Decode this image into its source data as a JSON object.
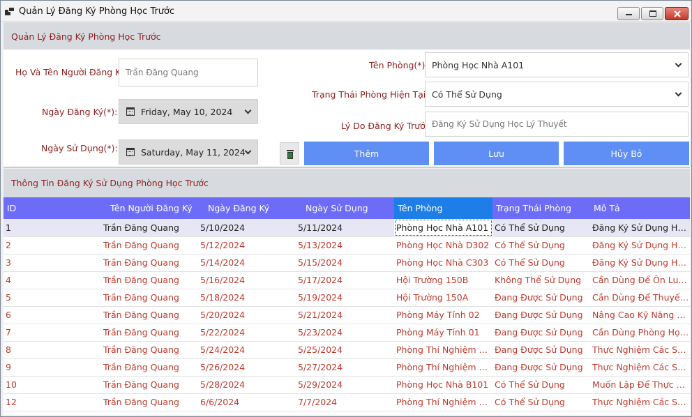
{
  "window": {
    "title": "Quản Lý Đăng Ký Phòng Học Trước"
  },
  "form_group": {
    "title": "Quản Lý Đăng Ký Phòng Học Trước",
    "requester_label": "Họ Và Tên Người Đăng Ký:",
    "requester_value": "Trần Đăng Quang",
    "register_date_label": "Ngày Đăng Ký(*):",
    "register_date_value": "Friday, May 10, 2024",
    "use_date_label": "Ngày Sử Dụng(*):",
    "use_date_value": "Saturday, May 11, 2024",
    "room_label": "Tên Phòng(*):",
    "room_value": "Phòng Học Nhà A101",
    "status_label": "Trạng Thái Phòng Hiện Tại(*):",
    "status_value": "Có Thể Sử Dụng",
    "reason_label": "Lý Do Đăng Ký Trước:",
    "reason_value": "Đăng Ký Sử Dụng Học Lý Thuyết",
    "add_label": "Thêm",
    "save_label": "Lưu",
    "cancel_label": "Hủy Bỏ"
  },
  "grid_group": {
    "title": "Thông Tin Đăng Ký Sử Dụng Phòng Học Trước",
    "columns": [
      "ID",
      "Tên Người Đăng Ký",
      "Ngày Đăng Ký",
      "Ngày Sử Dụng",
      "Tên Phòng",
      "Trạng Thái Phòng",
      "Mô Tả"
    ],
    "rows": [
      [
        "1",
        "Trần Đăng Quang",
        "5/10/2024",
        "5/11/2024",
        "Phòng Học Nhà A101",
        "Có Thể Sử Dụng",
        "Đăng Ký Sử Dụng Học L..."
      ],
      [
        "2",
        "Trần Đăng Quang",
        "5/12/2024",
        "5/13/2024",
        "Phòng Học Nhà D302",
        "Có Thể Sử Dụng",
        "Đăng Ký Sử Dụng Học ..."
      ],
      [
        "3",
        "Trần Đăng Quang",
        "5/14/2024",
        "5/15/2024",
        "Phòng Học Nhà C303",
        "Có Thể Sử Dụng",
        "Đăng Ký Sử Dụng Học ..."
      ],
      [
        "4",
        "Trần Đăng Quang",
        "5/16/2024",
        "5/17/2024",
        "Hội Trường 150B",
        "Không Thể Sử Dụng",
        "Cần Dùng Để Ôn Luyện..."
      ],
      [
        "5",
        "Trần Đăng Quang",
        "5/18/2024",
        "5/19/2024",
        "Hội Trường 150A",
        "Đang Được Sử Dụng",
        "Cần Dùng Để Thuyết Tri..."
      ],
      [
        "6",
        "Trần Đăng Quang",
        "5/20/2024",
        "5/21/2024",
        "Phòng Máy Tính 02",
        "Đang Được Sử Dụng",
        "Nâng Cao Kỹ Năng Dù..."
      ],
      [
        "7",
        "Trần Đăng Quang",
        "5/22/2024",
        "5/23/2024",
        "Phòng Máy Tính 01",
        "Đang Được Sử Dụng",
        "Cần Dùng Phòng Học ..."
      ],
      [
        "8",
        "Trần Đăng Quang",
        "5/24/2024",
        "5/25/2024",
        "Phòng Thí Nghiệm Côn...",
        "Đang Được Sử Dụng",
        "Thực Nghiệm Các Sản ..."
      ],
      [
        "9",
        "Trần Đăng Quang",
        "5/26/2024",
        "5/27/2024",
        "Phòng Thí Nghiệm Hóa...",
        "Đang Được Sử Dụng",
        "Thực Nghiệm Các Sản ..."
      ],
      [
        "10",
        "Trần Đăng Quang",
        "5/28/2024",
        "5/29/2024",
        "Phòng Học Nhà B101",
        "Có Thể Sử Dụng",
        "Muốn Lập Để Thực Hàn..."
      ],
      [
        "12",
        "Trần Đăng Quang",
        "6/6/2024",
        "7/7/2024",
        "Phòng Thí Nghiệm Sin...",
        "Có Thể Sử Dụng",
        "Thực Nghiệm Các Sản ..."
      ]
    ]
  },
  "colors": {
    "header_blue": "#6c6cf8",
    "selected_header": "#1e7ee8",
    "button_blue": "#5f8ef5",
    "label_red": "#8b1e1e",
    "row_text_red": "#c0392b"
  },
  "icons": [
    "app-icon",
    "minimize-icon",
    "maximize-icon",
    "close-icon",
    "calendar-icon",
    "chevron-down-icon",
    "trash-icon"
  ]
}
